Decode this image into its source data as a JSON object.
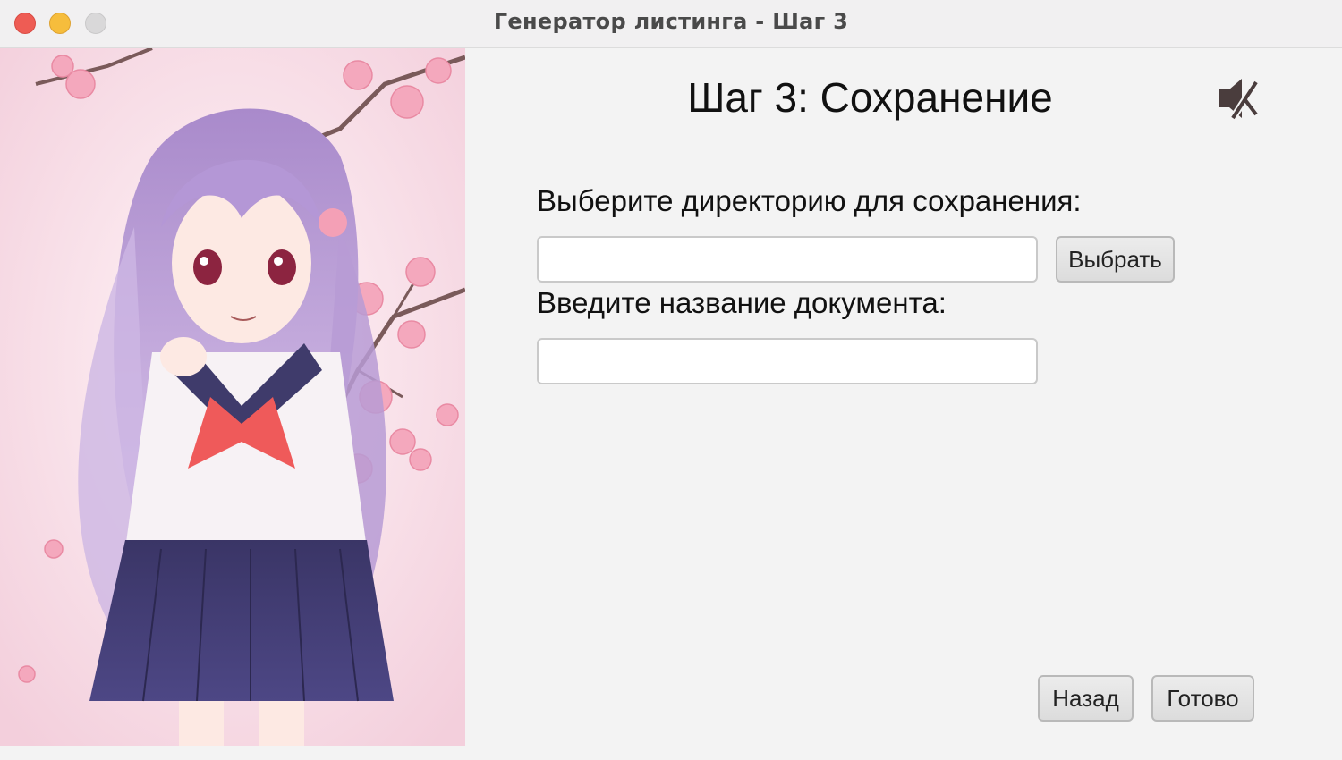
{
  "window": {
    "title": "Генератор листинга - Шаг 3"
  },
  "main": {
    "step_title": "Шаг 3: Сохранение",
    "directory_label": "Выберите директорию для сохранения:",
    "directory_value": "",
    "choose_button": "Выбрать",
    "document_name_label": "Введите название документа:",
    "document_name_value": "",
    "back_button": "Назад",
    "done_button": "Готово",
    "sound_icon": "speaker-muted-icon"
  },
  "colors": {
    "close": "#ee5c54",
    "minimize": "#f6bd3c",
    "maximize": "#d9d8d9",
    "background": "#f3f3f3"
  }
}
